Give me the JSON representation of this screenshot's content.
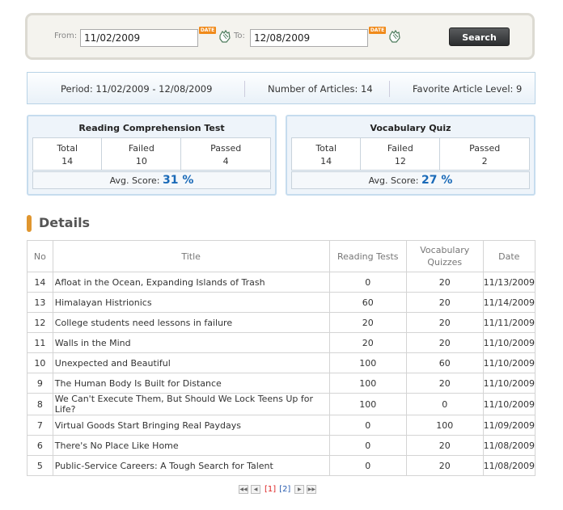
{
  "search": {
    "from_label": "From:",
    "from_value": "11/02/2009",
    "to_label": "To:",
    "to_value": "12/08/2009",
    "date_badge": "DATE",
    "button_label": "Search"
  },
  "summary": {
    "period": "Period: 11/02/2009 - 12/08/2009",
    "articles": "Number of Articles: 14",
    "favorite": "Favorite Article Level: 9"
  },
  "reading": {
    "title": "Reading Comprehension Test",
    "total_label": "Total",
    "total": "14",
    "failed_label": "Failed",
    "failed": "10",
    "passed_label": "Passed",
    "passed": "4",
    "avg_label": "Avg. Score:",
    "avg_value": "31 %"
  },
  "vocab": {
    "title": "Vocabulary Quiz",
    "total_label": "Total",
    "total": "14",
    "failed_label": "Failed",
    "failed": "12",
    "passed_label": "Passed",
    "passed": "2",
    "avg_label": "Avg. Score:",
    "avg_value": "27 %"
  },
  "details": {
    "heading": "Details",
    "columns": [
      "No",
      "Title",
      "Reading Tests",
      "Vocabulary Quizzes",
      "Date"
    ],
    "rows": [
      [
        "14",
        "Afloat in the Ocean, Expanding Islands of Trash",
        "0",
        "20",
        "11/13/2009"
      ],
      [
        "13",
        "Himalayan Histrionics",
        "60",
        "20",
        "11/14/2009"
      ],
      [
        "12",
        "College students need lessons in failure",
        "20",
        "20",
        "11/11/2009"
      ],
      [
        "11",
        "Walls in the Mind",
        "20",
        "20",
        "11/10/2009"
      ],
      [
        "10",
        "Unexpected and Beautiful",
        "100",
        "60",
        "11/10/2009"
      ],
      [
        "9",
        "The Human Body Is Built for Distance",
        "100",
        "20",
        "11/10/2009"
      ],
      [
        "8",
        "We Can't Execute Them, But Should We Lock Teens Up for Life?",
        "100",
        "0",
        "11/10/2009"
      ],
      [
        "7",
        "Virtual Goods Start Bringing Real Paydays",
        "0",
        "100",
        "11/09/2009"
      ],
      [
        "6",
        "There's No Place Like Home",
        "0",
        "20",
        "11/08/2009"
      ],
      [
        "5",
        "Public-Service Careers: A Tough Search for Talent",
        "0",
        "20",
        "11/08/2009"
      ]
    ]
  },
  "pagination": {
    "current": "[1]",
    "other": "[2]"
  }
}
